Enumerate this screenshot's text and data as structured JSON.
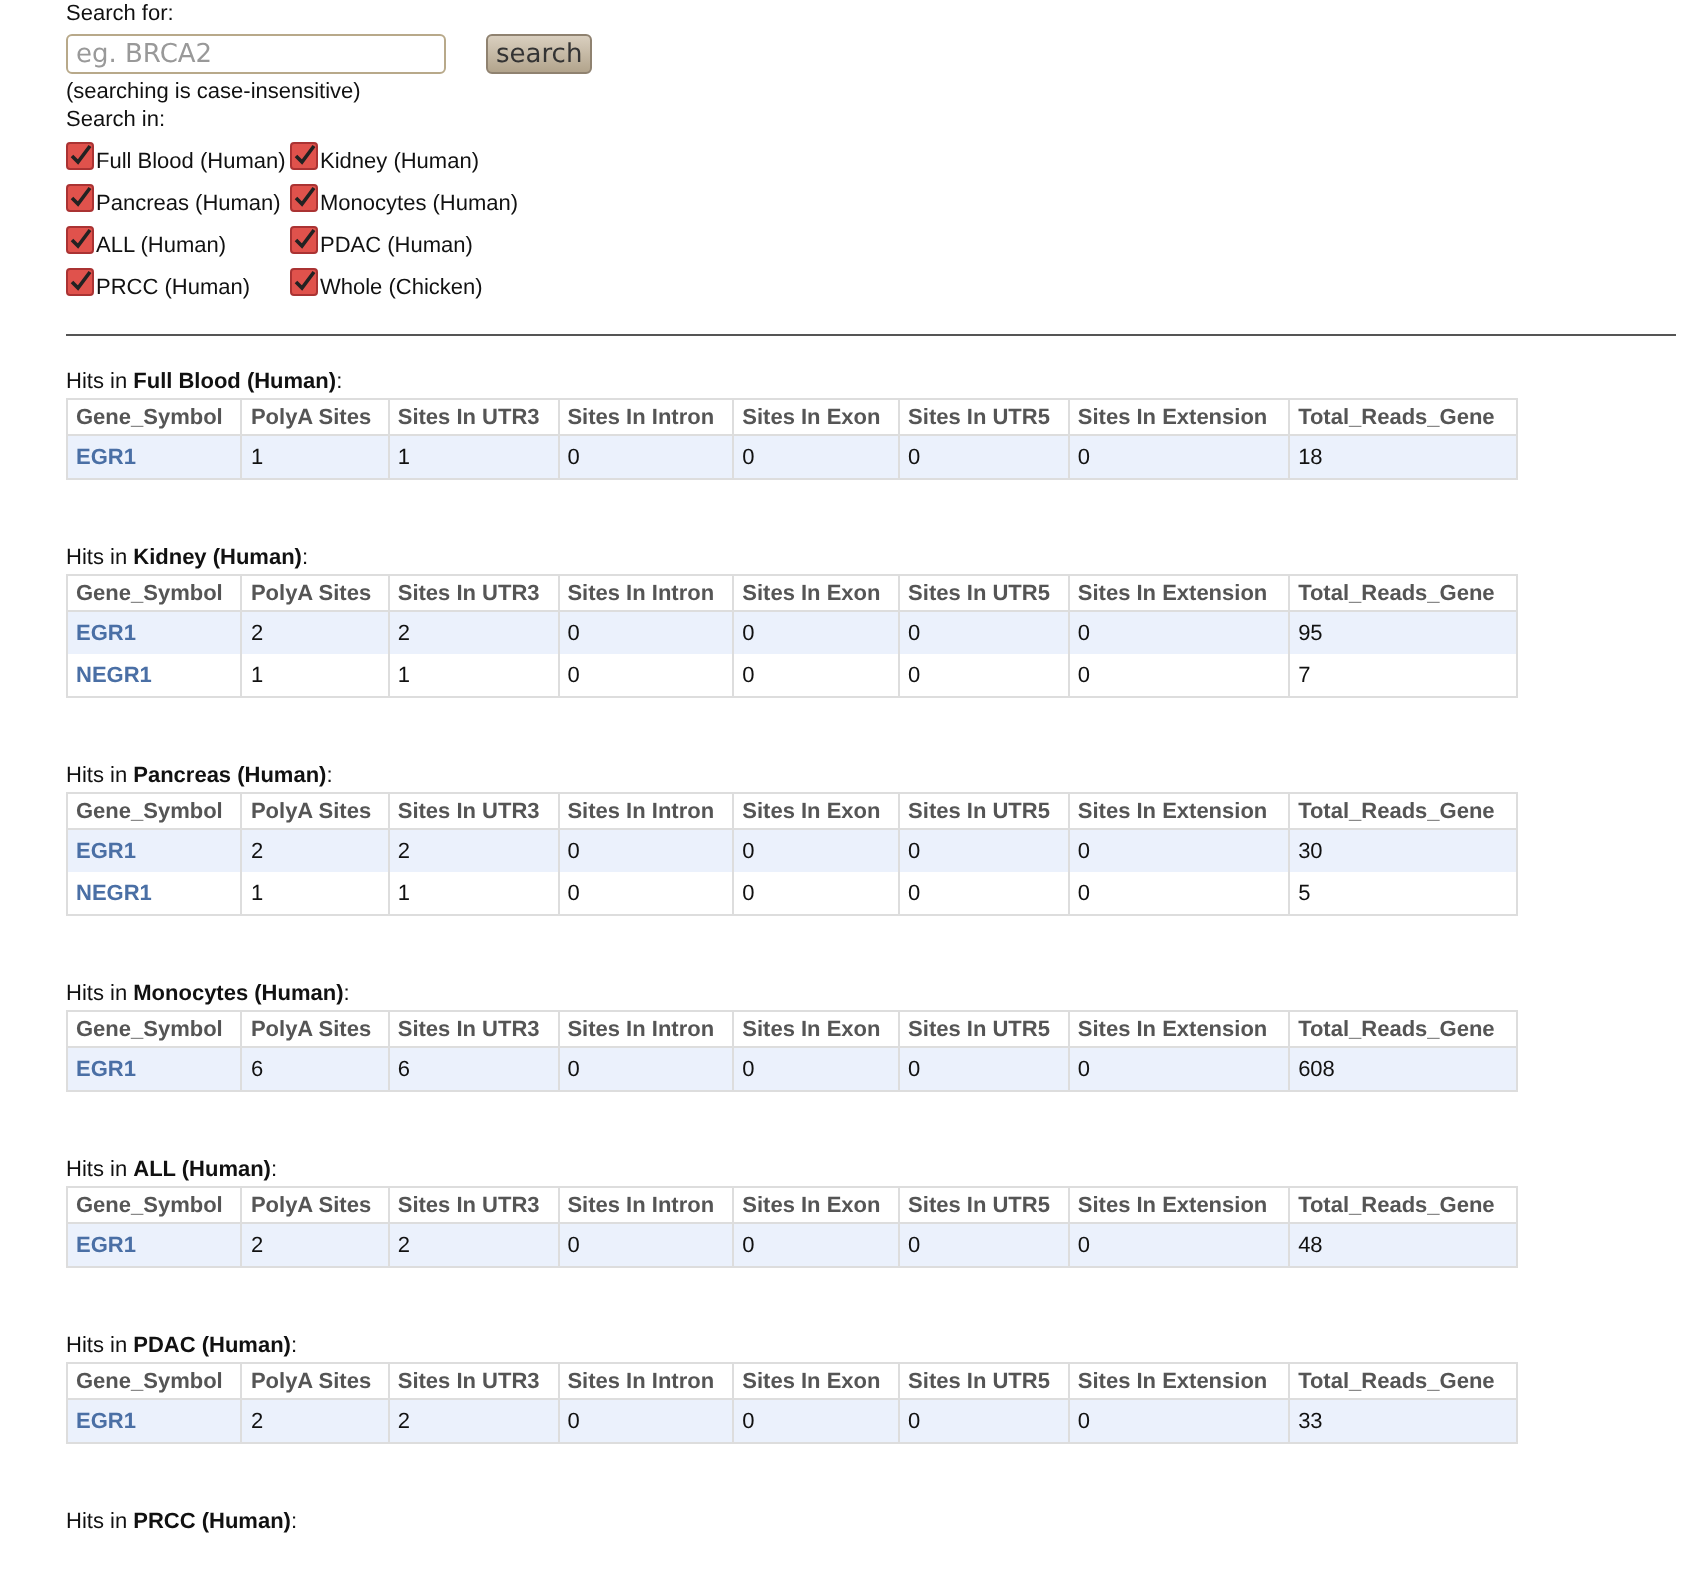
{
  "search": {
    "label": "Search for:",
    "placeholder": "eg. BRCA2",
    "button": "search",
    "note": "(searching is case-insensitive)"
  },
  "search_in": {
    "label": "Search in:",
    "sources": [
      {
        "label": "Full Blood (Human)",
        "checked": true
      },
      {
        "label": "Kidney (Human)",
        "checked": true
      },
      {
        "label": "Pancreas (Human)",
        "checked": true
      },
      {
        "label": "Monocytes (Human)",
        "checked": true
      },
      {
        "label": "ALL (Human)",
        "checked": true
      },
      {
        "label": "PDAC (Human)",
        "checked": true
      },
      {
        "label": "PRCC (Human)",
        "checked": true
      },
      {
        "label": "Whole (Chicken)",
        "checked": true
      }
    ]
  },
  "results": [
    {
      "heading": "Hits in **Full Blood (Human)**:",
      "columns": [
        "Gene_Symbol",
        "PolyA Sites",
        "Sites In UTR3",
        "Sites In Intron",
        "Sites In Exon",
        "Sites In UTR5",
        "Sites In Extension",
        "Total_Reads_Gene"
      ],
      "rows": [
        [
          "EGR1",
          "1",
          "1",
          "0",
          "0",
          "0",
          "0",
          "18"
        ]
      ]
    },
    {
      "heading": "Hits in **Kidney (Human)**:",
      "columns": [
        "Gene_Symbol",
        "PolyA Sites",
        "Sites In UTR3",
        "Sites In Intron",
        "Sites In Exon",
        "Sites In UTR5",
        "Sites In Extension",
        "Total_Reads_Gene"
      ],
      "rows": [
        [
          "EGR1",
          "2",
          "2",
          "0",
          "0",
          "0",
          "0",
          "95"
        ],
        [
          "NEGR1",
          "1",
          "1",
          "0",
          "0",
          "0",
          "0",
          "7"
        ]
      ]
    },
    {
      "heading": "Hits in **Pancreas (Human)**:",
      "columns": [
        "Gene_Symbol",
        "PolyA Sites",
        "Sites In UTR3",
        "Sites In Intron",
        "Sites In Exon",
        "Sites In UTR5",
        "Sites In Extension",
        "Total_Reads_Gene"
      ],
      "rows": [
        [
          "EGR1",
          "2",
          "2",
          "0",
          "0",
          "0",
          "0",
          "30"
        ],
        [
          "NEGR1",
          "1",
          "1",
          "0",
          "0",
          "0",
          "0",
          "5"
        ]
      ]
    },
    {
      "heading": "Hits in **Monocytes (Human)**:",
      "columns": [
        "Gene_Symbol",
        "PolyA Sites",
        "Sites In UTR3",
        "Sites In Intron",
        "Sites In Exon",
        "Sites In UTR5",
        "Sites In Extension",
        "Total_Reads_Gene"
      ],
      "rows": [
        [
          "EGR1",
          "6",
          "6",
          "0",
          "0",
          "0",
          "0",
          "608"
        ]
      ]
    },
    {
      "heading": "Hits in **ALL (Human)**:",
      "columns": [
        "Gene_Symbol",
        "PolyA Sites",
        "Sites In UTR3",
        "Sites In Intron",
        "Sites In Exon",
        "Sites In UTR5",
        "Sites In Extension",
        "Total_Reads_Gene"
      ],
      "rows": [
        [
          "EGR1",
          "2",
          "2",
          "0",
          "0",
          "0",
          "0",
          "48"
        ]
      ]
    },
    {
      "heading": "Hits in **PDAC (Human)**:",
      "columns": [
        "Gene_Symbol",
        "PolyA Sites",
        "Sites In UTR3",
        "Sites In Intron",
        "Sites In Exon",
        "Sites In UTR5",
        "Sites In Extension",
        "Total_Reads_Gene"
      ],
      "rows": [
        [
          "EGR1",
          "2",
          "2",
          "0",
          "0",
          "0",
          "0",
          "33"
        ]
      ]
    },
    {
      "heading": "Hits in **PRCC (Human)**:"
    }
  ]
}
